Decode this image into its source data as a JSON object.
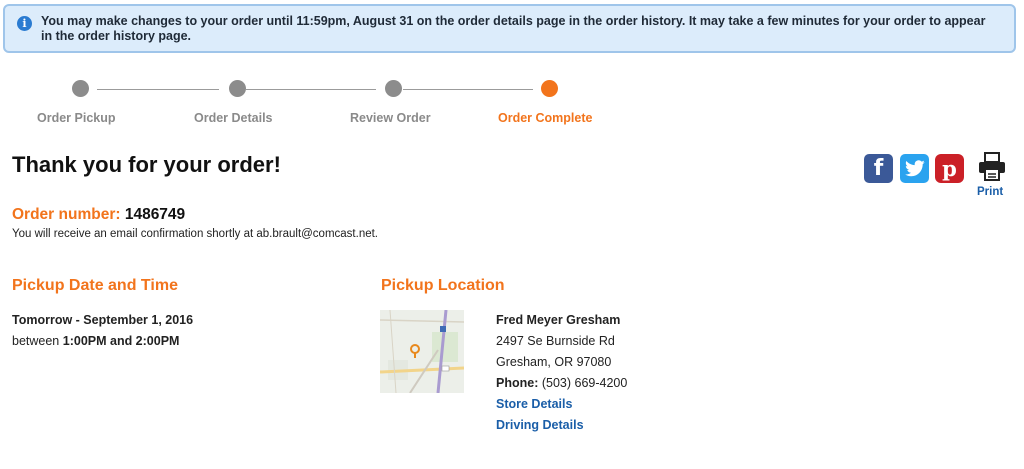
{
  "notice": {
    "icon": "info-icon",
    "text": "You may make changes to your order until 11:59pm, August 31 on the order details page in the order history. It may take a few minutes for your order to appear in the order history page."
  },
  "stepper": {
    "steps": [
      {
        "label": "Order Pickup",
        "active": false
      },
      {
        "label": "Order Details",
        "active": false
      },
      {
        "label": "Review Order",
        "active": false
      },
      {
        "label": "Order Complete",
        "active": true
      }
    ],
    "active_color": "#f2741c",
    "inactive_color": "#8c8c8c"
  },
  "title": "Thank you for your order!",
  "share": {
    "icons": [
      "facebook-icon",
      "twitter-icon",
      "pinterest-icon",
      "printer-icon"
    ],
    "print_label": "Print"
  },
  "order": {
    "number_label": "Order number:",
    "number": "1486749",
    "email_note": "You will receive an email confirmation shortly at ab.brault@comcast.net."
  },
  "pickup_time": {
    "heading": "Pickup Date and Time",
    "date": "Tomorrow - September 1, 2016",
    "between": "between",
    "window": "1:00PM and 2:00PM"
  },
  "pickup_location": {
    "heading": "Pickup Location",
    "store_name": "Fred Meyer Gresham",
    "street": "2497 Se Burnside Rd",
    "city": "Gresham, OR 97080",
    "phone_label": "Phone:",
    "phone": "(503) 669-4200",
    "store_details_link": "Store Details",
    "driving_details_link": "Driving Details"
  },
  "colors": {
    "accent": "#f2741c",
    "link": "#1a5ea8",
    "notice_bg": "#dcecfb"
  }
}
